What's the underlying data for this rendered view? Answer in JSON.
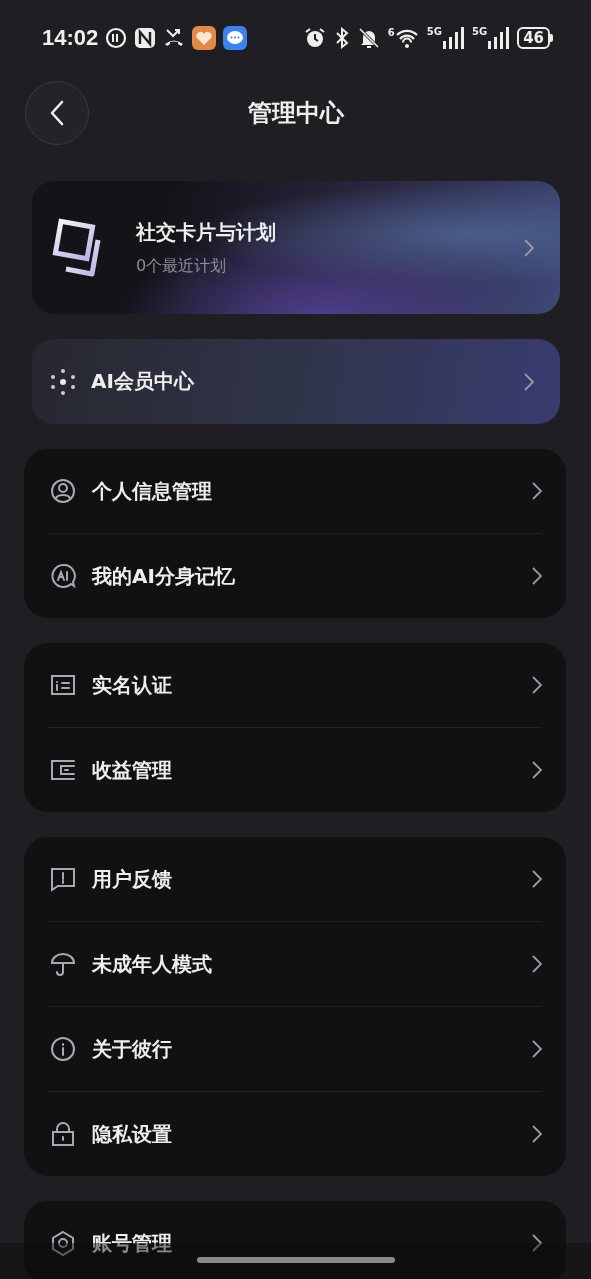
{
  "status_bar": {
    "time": "14:02",
    "wifi_label": "6",
    "signal_labels": [
      "5G",
      "5G"
    ],
    "battery": "46"
  },
  "header": {
    "title": "管理中心"
  },
  "social_card": {
    "title": "社交卡片与计划",
    "subtitle": "0个最近计划"
  },
  "ai_card": {
    "title": "AI会员中心"
  },
  "groups": [
    {
      "items": [
        {
          "label": "个人信息管理"
        },
        {
          "label": "我的AI分身记忆"
        }
      ]
    },
    {
      "items": [
        {
          "label": "实名认证"
        },
        {
          "label": "收益管理"
        }
      ]
    },
    {
      "items": [
        {
          "label": "用户反馈"
        },
        {
          "label": "未成年人模式"
        },
        {
          "label": "关于彼行"
        },
        {
          "label": "隐私设置"
        }
      ]
    },
    {
      "items": [
        {
          "label": "账号管理"
        }
      ]
    }
  ]
}
